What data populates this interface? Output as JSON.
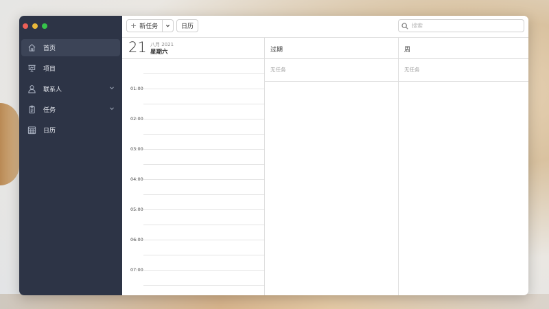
{
  "window": {
    "title": ""
  },
  "sidebar": {
    "items": [
      {
        "label": "首页",
        "icon": "home-icon",
        "active": true
      },
      {
        "label": "项目",
        "icon": "presentation-icon"
      },
      {
        "label": "联系人",
        "icon": "person-icon",
        "expandable": true
      },
      {
        "label": "任务",
        "icon": "clipboard-icon",
        "expandable": true
      },
      {
        "label": "日历",
        "icon": "calendar-grid-icon"
      }
    ]
  },
  "toolbar": {
    "new_task_label": "新任务",
    "calendar_label": "日历",
    "search_placeholder": "搜索"
  },
  "today": {
    "day": "21",
    "month_year": "八月 2021",
    "weekday": "星期六",
    "hours": [
      "01:00",
      "02:00",
      "03:00",
      "04:00",
      "05:00",
      "06:00",
      "07:00"
    ]
  },
  "overdue": {
    "title": "过期",
    "empty_text": "无任务"
  },
  "week": {
    "title": "周",
    "empty_text": "无任务"
  },
  "colors": {
    "sidebar_bg": "#2d3446",
    "sidebar_active": "#3c4457"
  }
}
